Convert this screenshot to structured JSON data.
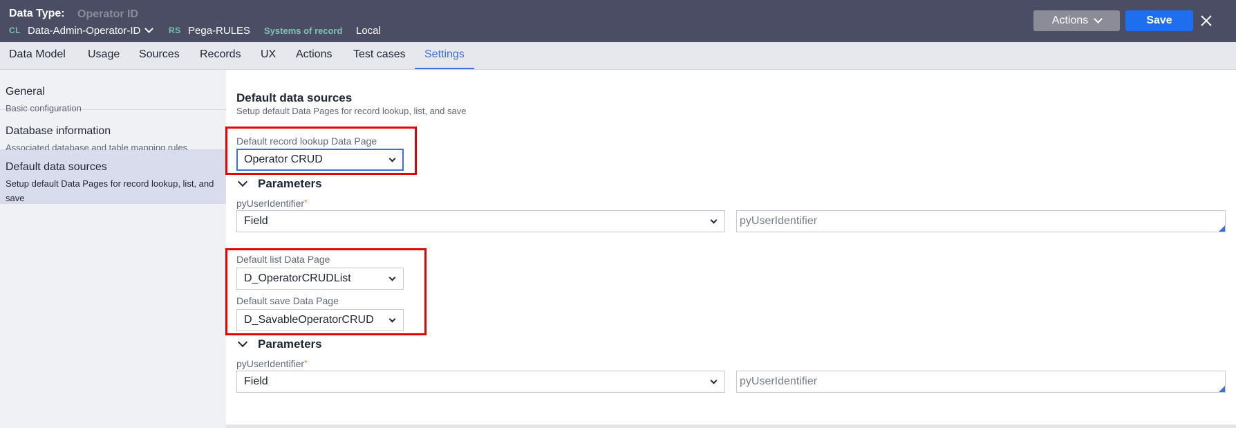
{
  "header": {
    "title_label": "Data Type:",
    "title_value": "Operator ID",
    "class_tag": "CL",
    "class_value": "Data-Admin-Operator-ID",
    "ruleset_tag": "RS",
    "ruleset_value": "Pega-RULES",
    "sor_tag": "Systems of record",
    "sor_value": "Local",
    "actions_label": "Actions",
    "save_label": "Save"
  },
  "tabs": [
    {
      "label": "Data Model"
    },
    {
      "label": "Usage"
    },
    {
      "label": "Sources"
    },
    {
      "label": "Records"
    },
    {
      "label": "UX"
    },
    {
      "label": "Actions"
    },
    {
      "label": "Test cases"
    },
    {
      "label": "Settings",
      "active": true
    }
  ],
  "sidebar": {
    "items": [
      {
        "title": "General",
        "subtitle": "Basic configuration"
      },
      {
        "title": "Database information",
        "subtitle": "Associated database and table mapping rules"
      },
      {
        "title": "Default data sources",
        "subtitle": "Setup default Data Pages for record lookup, list, and save",
        "active": true
      }
    ]
  },
  "main": {
    "title": "Default data sources",
    "subtitle": "Setup default Data Pages for record lookup, list, and save",
    "lookup": {
      "label": "Default record lookup Data Page",
      "value": "Operator CRUD"
    },
    "params1": {
      "heading": "Parameters",
      "param_label": "pyUserIdentifier",
      "required_mark": "*",
      "source_value": "Field",
      "input_value": "pyUserIdentifier"
    },
    "list": {
      "label": "Default list Data Page",
      "value": "D_OperatorCRUDList"
    },
    "save": {
      "label": "Default save Data Page",
      "value": "D_SavableOperatorCRUD"
    },
    "params2": {
      "heading": "Parameters",
      "param_label": "pyUserIdentifier",
      "required_mark": "*",
      "source_value": "Field",
      "input_value": "pyUserIdentifier"
    }
  },
  "colors": {
    "header_bg": "#4a4d63",
    "accent": "#3d6fd6",
    "save_button": "#1e6ef0",
    "highlight": "#e60000"
  }
}
